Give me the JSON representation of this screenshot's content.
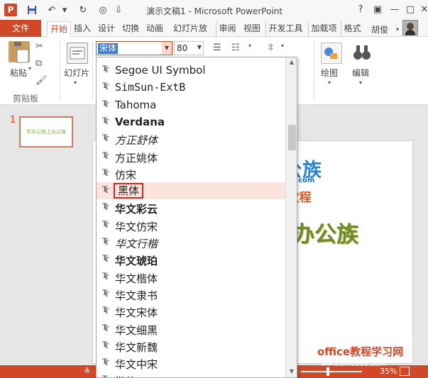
{
  "window": {
    "title": "演示文稿1 - Microsoft PowerPoint",
    "app_letter": "P",
    "accent": "#d24726"
  },
  "quick_access": {
    "save_icon": "save-icon",
    "undo_icon": "undo-icon",
    "redo_icon": "redo-icon"
  },
  "window_controls": {
    "help": "?",
    "minimize": "—",
    "maximize": "□",
    "close": "✕"
  },
  "tabs": [
    "文件",
    "开始",
    "插入",
    "设计",
    "切换",
    "动画",
    "幻灯片放",
    "审阅",
    "视图",
    "开发工具",
    "加载项",
    "格式"
  ],
  "active_tab": "开始",
  "user": "胡俊",
  "ribbon": {
    "paste_label": "粘贴",
    "clipboard_group": "剪贴板",
    "slides_label": "幻灯片",
    "drawing_label": "绘图",
    "editing_label": "编辑",
    "font_name": "宋体",
    "font_size": "80"
  },
  "font_list": [
    {
      "name": "Segoe UI Symbol"
    },
    {
      "name": "SimSun-ExtB"
    },
    {
      "name": "Tahoma"
    },
    {
      "name": "Verdana"
    },
    {
      "name": "方正舒体"
    },
    {
      "name": "方正姚体"
    },
    {
      "name": "仿宋"
    },
    {
      "name": "黑体"
    },
    {
      "name": "华文彩云"
    },
    {
      "name": "华文仿宋"
    },
    {
      "name": "华文行楷"
    },
    {
      "name": "华文琥珀"
    },
    {
      "name": "华文楷体"
    },
    {
      "name": "华文隶书"
    },
    {
      "name": "华文宋体"
    },
    {
      "name": "华文细黑"
    },
    {
      "name": "华文新魏"
    },
    {
      "name": "华文中宋"
    },
    {
      "name": "楷体"
    }
  ],
  "highlighted_font": "黑体",
  "slides": {
    "number": "1",
    "thumb_title": "学办公就上办公族",
    "slide_title": "办公族"
  },
  "status": {
    "zoom": "35%"
  },
  "watermarks": {
    "brand_cn": "办公族",
    "brand_url": "Officezu.com",
    "brand_tag": "PPT教程",
    "site_cn": "office教程学习网",
    "site_url": "www.office68.com"
  }
}
